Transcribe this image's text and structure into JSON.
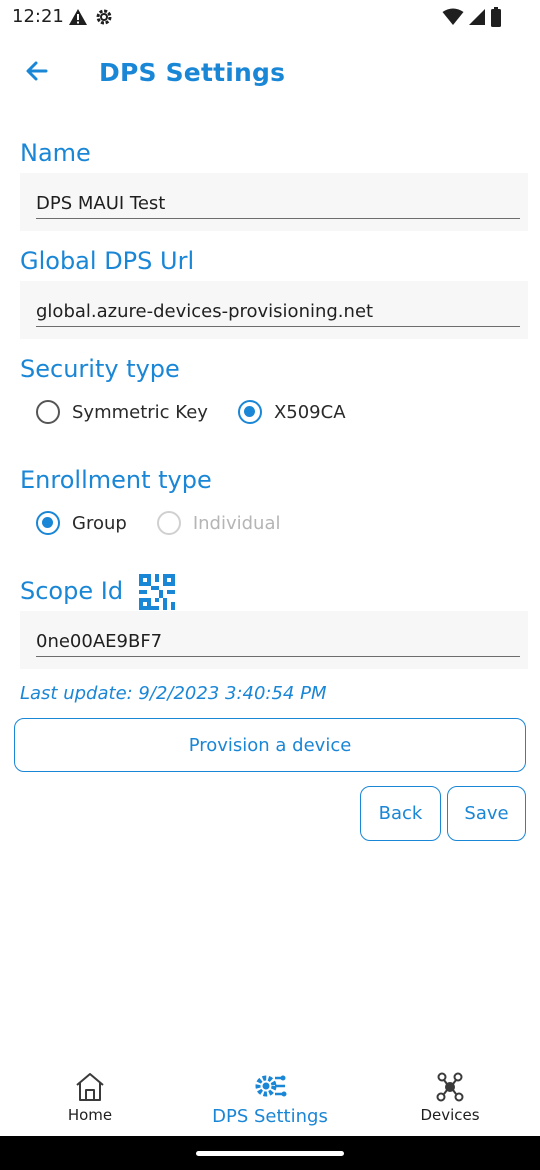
{
  "status": {
    "time": "12:21"
  },
  "appbar": {
    "title": "DPS Settings"
  },
  "name": {
    "label": "Name",
    "value": "DPS MAUI Test"
  },
  "global_url": {
    "label": "Global DPS Url",
    "value": "global.azure-devices-provisioning.net"
  },
  "security": {
    "label": "Security type",
    "options": [
      {
        "label": "Symmetric Key",
        "checked": false
      },
      {
        "label": "X509CA",
        "checked": true
      }
    ]
  },
  "enrollment": {
    "label": "Enrollment type",
    "options": [
      {
        "label": "Group",
        "checked": true
      },
      {
        "label": "Individual",
        "checked": false,
        "disabled": true
      }
    ]
  },
  "scope": {
    "label": "Scope Id",
    "value": "0ne00AE9BF7"
  },
  "last_update": "Last update: 9/2/2023 3:40:54 PM",
  "buttons": {
    "provision": "Provision a device",
    "back": "Back",
    "save": "Save"
  },
  "tabs": [
    {
      "label": "Home",
      "icon": "home-icon"
    },
    {
      "label": "DPS Settings",
      "icon": "settings-network-icon",
      "active": true
    },
    {
      "label": "Devices",
      "icon": "devices-hub-icon"
    }
  ],
  "colors": {
    "accent": "#1a86d6"
  }
}
